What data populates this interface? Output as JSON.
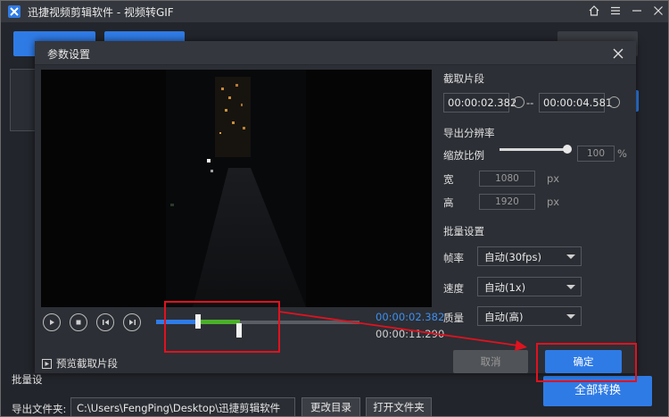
{
  "app": {
    "title": "迅捷视频剪辑软件 - 视频转GIF",
    "icons": [
      "app-logo-icon",
      "home-icon",
      "menu-icon",
      "minimize-icon",
      "close-icon"
    ]
  },
  "background": {
    "batch_label": "批量设",
    "output_label": "导出文件夹:",
    "output_path": "C:\\Users\\FengPing\\Desktop\\迅捷剪辑软件",
    "change_dir": "更改目录",
    "open_folder": "打开文件夹",
    "convert_all": "全部转换"
  },
  "dialog": {
    "title": "参数设置",
    "clip_section": "截取片段",
    "start_time": "00:00:02.382",
    "end_time": "00:00:04.581",
    "range_sep": "--",
    "resolution_section": "导出分辨率",
    "scale_label": "缩放比例",
    "scale_value": "100",
    "scale_unit": "%",
    "scale_fraction": 1.0,
    "width_label": "宽",
    "width_value": "1080",
    "height_label": "高",
    "height_value": "1920",
    "px_unit": "px",
    "batch_section": "批量设置",
    "fps_label": "帧率",
    "fps_value": "自动(30fps)",
    "speed_label": "速度",
    "speed_value": "自动(1x)",
    "quality_label": "质量",
    "quality_value": "自动(高)",
    "current_time": "00:00:02.382",
    "total_time": "00:00:11.290",
    "preview_clip": "预览截取片段",
    "cancel": "取消",
    "ok": "确定"
  },
  "colors": {
    "accent": "#2f7be6",
    "selection": "#4caf2a",
    "highlight": "#e0121f",
    "dialog_bg": "#2c2f35"
  }
}
